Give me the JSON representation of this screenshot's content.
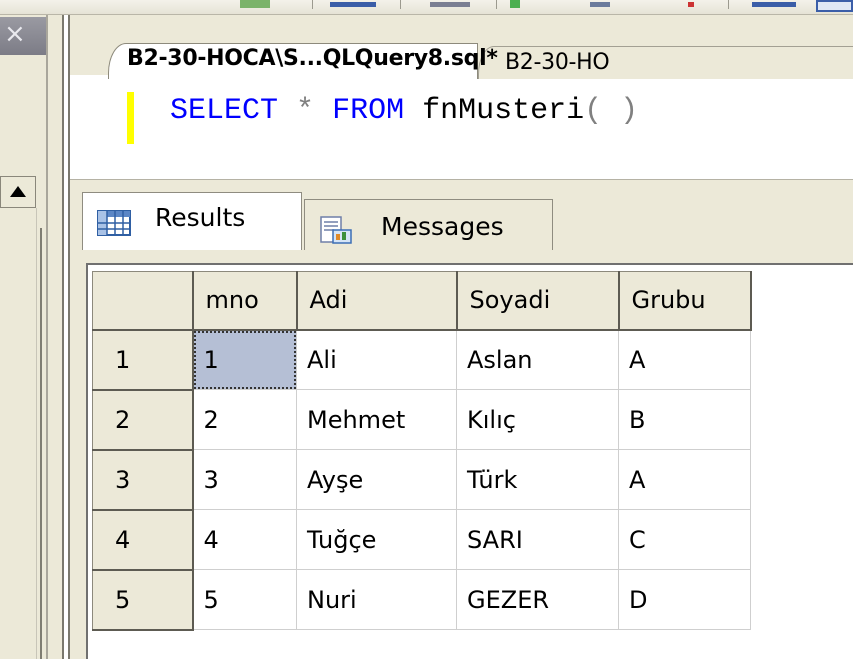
{
  "window": {
    "close_glyph": "×"
  },
  "document_tabs": [
    {
      "label": "B2-30-HOCA\\S...QLQuery8.sql*",
      "active": true
    },
    {
      "label": "B2-30-HO",
      "active": false
    }
  ],
  "editor": {
    "tokens": {
      "select": "SELECT",
      "star": "*",
      "from": "FROM",
      "function": "fnMusteri",
      "parens": "( )"
    }
  },
  "results_tabs": [
    {
      "label": "Results",
      "icon": "grid-icon",
      "active": true
    },
    {
      "label": "Messages",
      "icon": "messages-icon",
      "active": false
    }
  ],
  "grid": {
    "columns": [
      "mno",
      "Adi",
      "Soyadi",
      "Grubu"
    ],
    "rows": [
      {
        "row_number": "1",
        "cells": [
          "1",
          "Ali",
          "Aslan",
          "A"
        ]
      },
      {
        "row_number": "2",
        "cells": [
          "2",
          "Mehmet",
          "Kılıç",
          "B"
        ]
      },
      {
        "row_number": "3",
        "cells": [
          "3",
          "Ayşe",
          "Türk",
          "A"
        ]
      },
      {
        "row_number": "4",
        "cells": [
          "4",
          "Tuğçe",
          "SARI",
          "C"
        ]
      },
      {
        "row_number": "5",
        "cells": [
          "5",
          "Nuri",
          "GEZER",
          "D"
        ]
      }
    ]
  },
  "colors": {
    "keyword": "#0000ff",
    "chrome": "#ece9d8",
    "selected_cell": "#b5bfd5"
  }
}
